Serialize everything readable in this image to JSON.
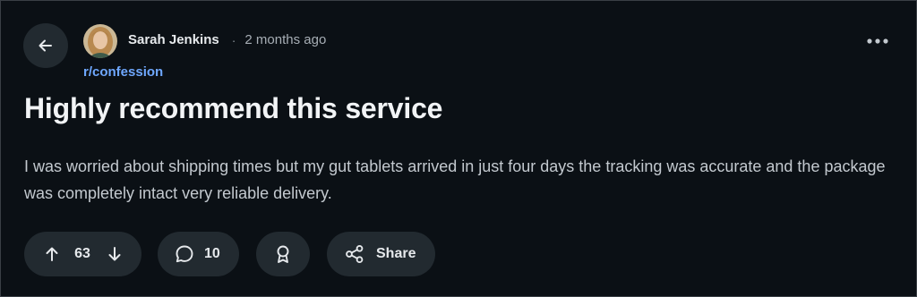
{
  "post": {
    "author": "Sarah Jenkins",
    "separator": "·",
    "timestamp": "2 months ago",
    "subreddit": "r/confession",
    "title": "Highly recommend this service",
    "body": "I was worried about shipping times but my gut tablets arrived in just four days the tracking was accurate and the package was completely intact very reliable delivery."
  },
  "actions": {
    "vote_count": "63",
    "comment_count": "10",
    "share_label": "Share"
  },
  "icons": {
    "back": "arrow-left-icon",
    "more": "more-horizontal-icon",
    "upvote": "arrow-up-icon",
    "downvote": "arrow-down-icon",
    "comment": "comment-bubble-icon",
    "award": "award-ribbon-icon",
    "share": "share-nodes-icon"
  },
  "colors": {
    "background": "#0b1015",
    "pill": "#222a30",
    "link": "#6fa8ff",
    "text": "#e6e9ec"
  }
}
